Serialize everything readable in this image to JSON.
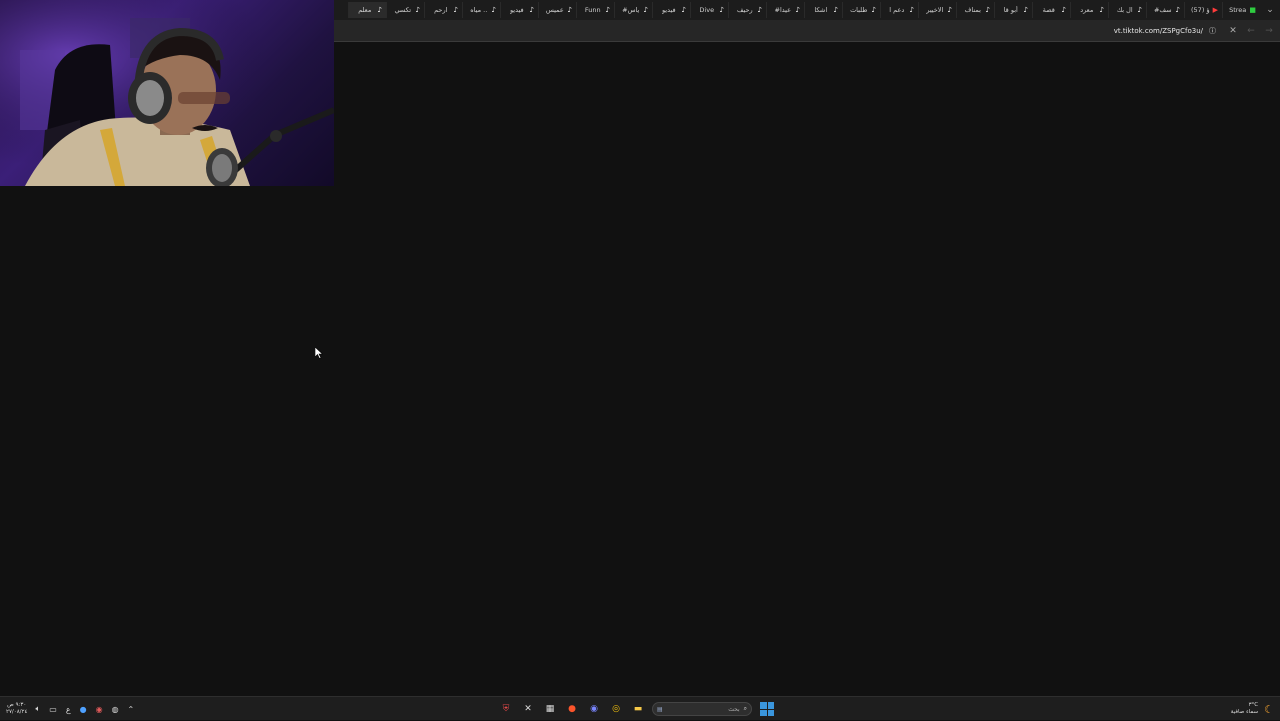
{
  "browser": {
    "tabs": [
      {
        "label": "Strea",
        "icon": "sheet-icon",
        "icon_color": "#2ecc40",
        "active": false
      },
      {
        "label": "(57) ؤ",
        "icon": "youtube-icon",
        "icon_color": "#ff3b3b",
        "active": false
      },
      {
        "label": "#سف",
        "icon": "tiktok-icon",
        "active": false
      },
      {
        "label": "ال بك",
        "icon": "tiktok-icon",
        "active": false
      },
      {
        "label": "معرد",
        "icon": "tiktok-icon",
        "active": false
      },
      {
        "label": "قصة",
        "icon": "tiktok-icon",
        "active": false
      },
      {
        "label": "أبو قا",
        "icon": "tiktok-icon",
        "active": false
      },
      {
        "label": "بمناف",
        "icon": "tiktok-icon",
        "active": false
      },
      {
        "label": "الاخيير",
        "icon": "tiktok-icon",
        "active": false
      },
      {
        "label": "دعم ا",
        "icon": "tiktok-icon",
        "active": false
      },
      {
        "label": "طلبات",
        "icon": "tiktok-icon",
        "active": false
      },
      {
        "label": "اشكا",
        "icon": "tiktok-icon",
        "active": false
      },
      {
        "label": "#عيدا",
        "icon": "tiktok-icon",
        "active": false
      },
      {
        "label": "رحيف",
        "icon": "tiktok-icon",
        "active": false
      },
      {
        "label": "Dive",
        "icon": "tiktok-icon",
        "active": false
      },
      {
        "label": "فيديو",
        "icon": "tiktok-icon",
        "active": false
      },
      {
        "label": "#ياس",
        "icon": "tiktok-icon",
        "active": false
      },
      {
        "label": "Funn",
        "icon": "tiktok-icon",
        "active": false
      },
      {
        "label": "عميس",
        "icon": "tiktok-icon",
        "active": false
      },
      {
        "label": "فيديو",
        "icon": "tiktok-icon",
        "active": false
      },
      {
        "label": "مياه ..",
        "icon": "tiktok-icon",
        "active": false
      },
      {
        "label": "ارحم",
        "icon": "tiktok-icon",
        "active": false
      },
      {
        "label": "تكسي",
        "icon": "tiktok-icon",
        "active": false
      },
      {
        "label": "معلم",
        "icon": "tiktok-icon",
        "active": true
      }
    ],
    "tab_menu_icon": "chevron-down-icon",
    "url": "vt.tiktok.com/ZSPgCfo3u/",
    "site_info_icon": "info-icon",
    "close_icon": "close-icon",
    "back_icon": "back-arrow-icon",
    "forward_icon": "forward-arrow-icon"
  },
  "taskbar": {
    "clock": {
      "time": "٩:٣٠ ص",
      "date": "٢٧/٠٨/٢٤"
    },
    "language": "ع",
    "search_placeholder": "بحث",
    "apps": [
      "antivirus-icon",
      "capcut-icon",
      "taskview-icon",
      "brave-icon",
      "discord-icon",
      "chrome-icon",
      "file-explorer-icon"
    ],
    "weather": {
      "temp": "٣°C",
      "desc": "سماء صافية"
    }
  },
  "colors": {
    "tiktok": "#ffffff",
    "youtube": "#ff3b3b",
    "sheets": "#2ecc40",
    "windows": "#3a96dd"
  }
}
